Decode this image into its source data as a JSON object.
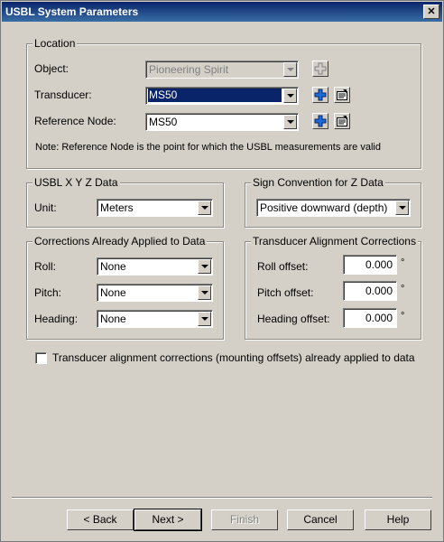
{
  "window": {
    "title": "USBL System Parameters",
    "close_glyph": "✕"
  },
  "location": {
    "legend": "Location",
    "object_label": "Object:",
    "object_value": "Pioneering Spirit",
    "transducer_label": "Transducer:",
    "transducer_value": "MS50",
    "refnode_label": "Reference Node:",
    "refnode_value": "MS50",
    "note": "Note: Reference Node is the point for which the USBL measurements are valid"
  },
  "xyz": {
    "legend": "USBL X Y Z Data",
    "unit_label": "Unit:",
    "unit_value": "Meters"
  },
  "sign": {
    "legend": "Sign Convention for Z Data",
    "value": "Positive downward (depth)"
  },
  "corrections": {
    "legend": "Corrections Already Applied to Data",
    "roll_label": "Roll:",
    "roll_value": "None",
    "pitch_label": "Pitch:",
    "pitch_value": "None",
    "heading_label": "Heading:",
    "heading_value": "None"
  },
  "alignment": {
    "legend": "Transducer Alignment Corrections",
    "roll_label": "Roll offset:",
    "roll_value": "0.000",
    "pitch_label": "Pitch offset:",
    "pitch_value": "0.000",
    "heading_label": "Heading offset:",
    "heading_value": "0.000",
    "degree_symbol": "°"
  },
  "checkbox": {
    "label": "Transducer alignment corrections (mounting offsets) already applied to data",
    "checked": false
  },
  "buttons": {
    "back": "< Back",
    "next": "Next >",
    "finish": "Finish",
    "cancel": "Cancel",
    "help": "Help"
  },
  "colors": {
    "accent": "#0a246a",
    "face": "#d4d0c8",
    "icon_blue": "#1c6cd8"
  }
}
